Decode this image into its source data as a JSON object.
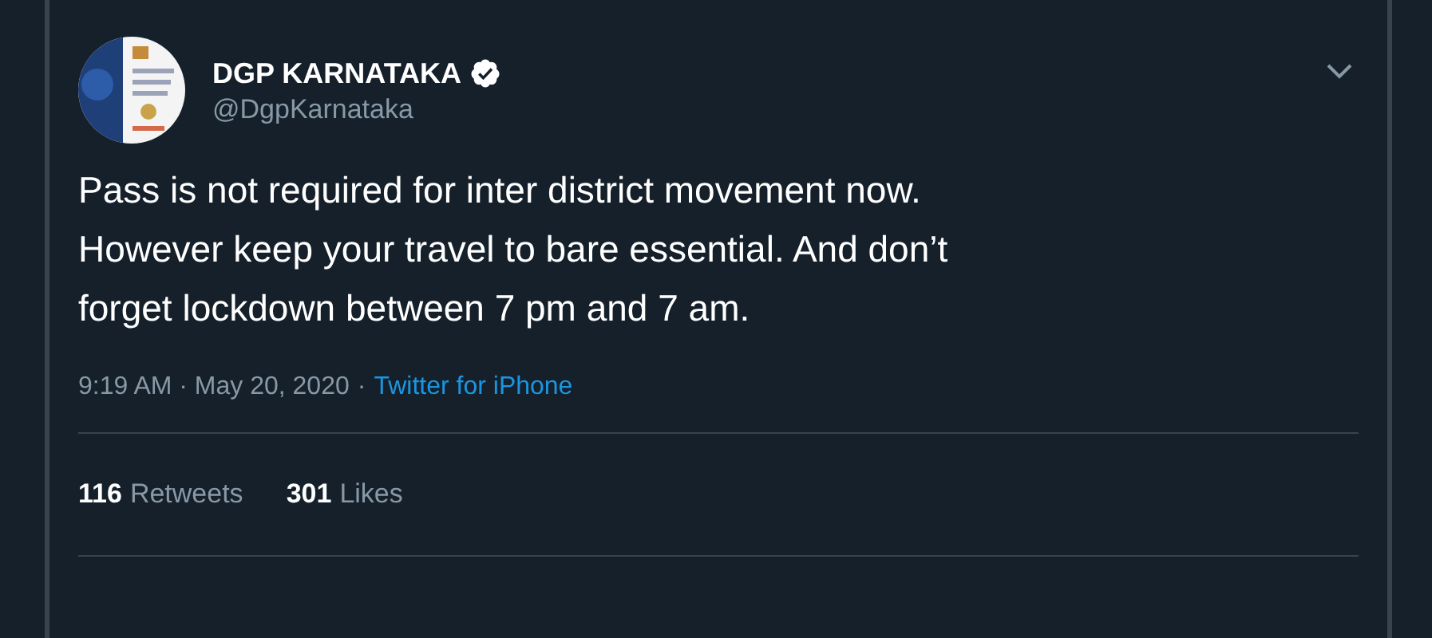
{
  "tweet": {
    "author": {
      "name": "DGP KARNATAKA",
      "verified": true,
      "handle": "@DgpKarnataka"
    },
    "text_lines": [
      "Pass is not required for inter district movement now.",
      "However keep your travel to bare essential. And don’t",
      "forget lockdown between 7 pm and 7 am."
    ],
    "timestamp": "9:19 AM · May 20, 2020",
    "separator": "·",
    "source": "Twitter for iPhone",
    "stats": [
      {
        "count": "116",
        "label": "Retweets"
      },
      {
        "count": "301",
        "label": "Likes"
      }
    ]
  }
}
